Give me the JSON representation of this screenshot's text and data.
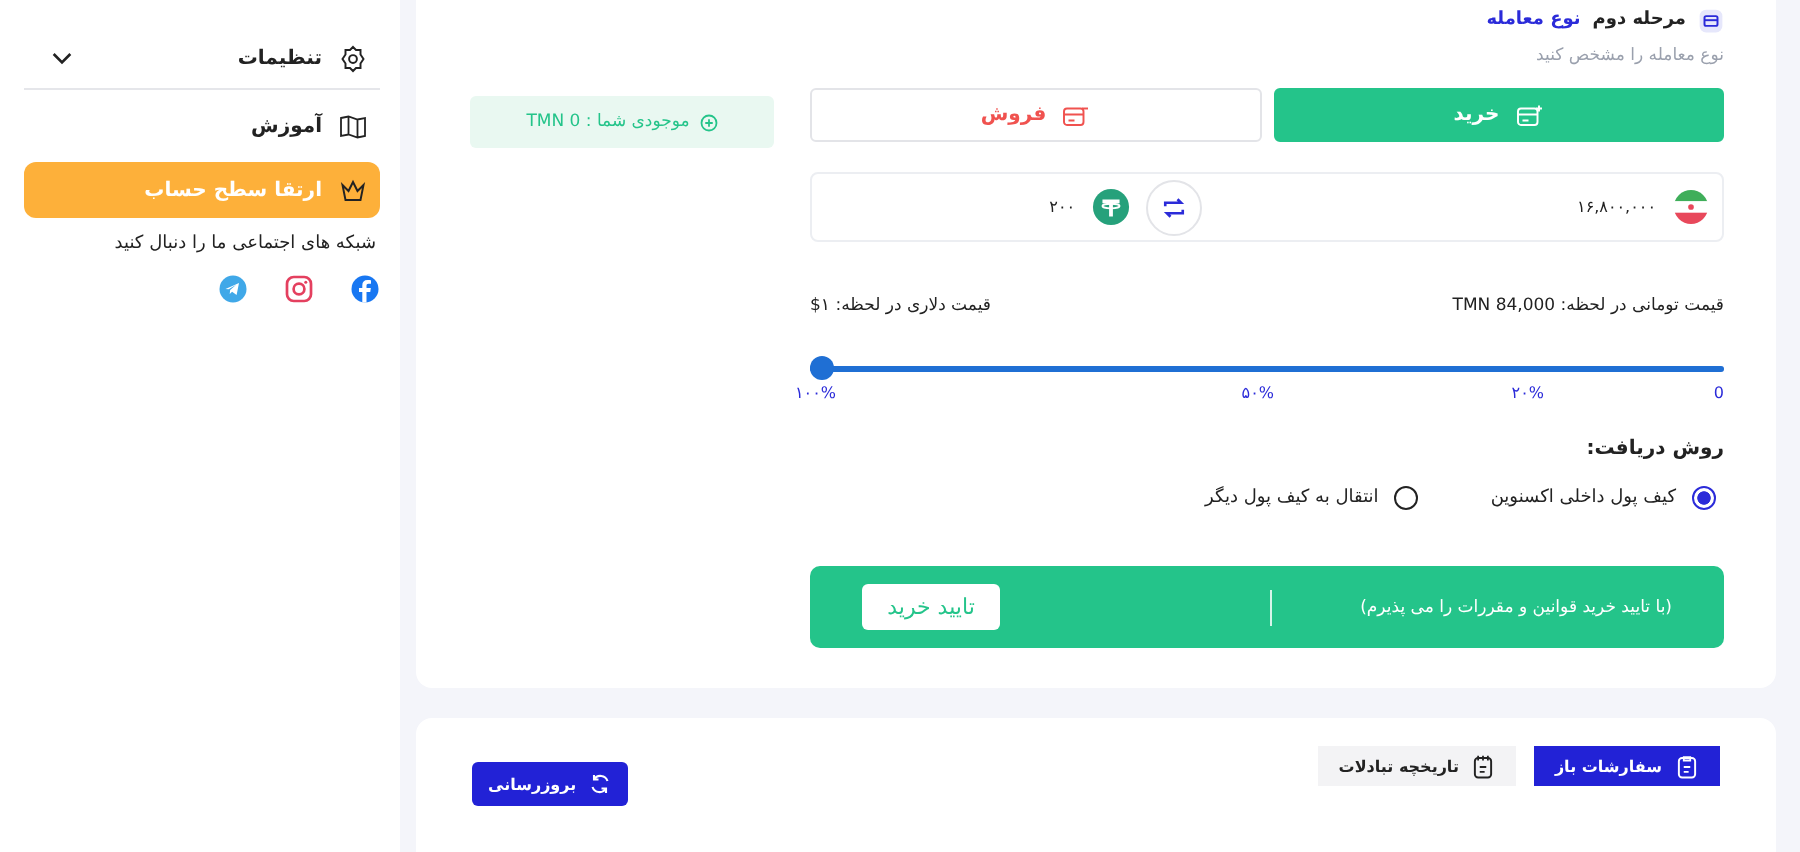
{
  "step": {
    "label": "مرحله دوم",
    "title": "نوع معامله",
    "hint": "نوع معامله را مشخص کنید"
  },
  "trade_types": [
    {
      "label": "خرید",
      "kind": "buy",
      "selected": true
    },
    {
      "label": "فروش",
      "kind": "sell",
      "selected": false
    }
  ],
  "balance": "موجودی شما : TMN 0",
  "converter": {
    "from_amount": "۱۶,۸۰۰,۰۰۰",
    "to_amount": "۲۰۰"
  },
  "prices": {
    "toman": "قیمت تومانی در لحظه: TMN 84,000",
    "dollar": "قیمت دلاری در لحظه: ۱$"
  },
  "slider": {
    "level": 1,
    "ticks": [
      "0",
      "۲۰%",
      "۵۰%",
      "۱۰۰%"
    ]
  },
  "delivery": {
    "label": "روش دریافت:",
    "options": [
      {
        "label": "کیف پول داخلی اکسنوین",
        "selected": true
      },
      {
        "label": "انتقال به کیف پول دیگر",
        "selected": false
      }
    ]
  },
  "confirm": {
    "terms": "(با تایید خرید قوانین و مقررات را می پذیرم)",
    "button": "تایید خرید"
  },
  "orders": {
    "tabs": [
      {
        "label": "سفارشات باز",
        "kind": "open",
        "selected": true
      },
      {
        "label": "تاریخچه تبادلات",
        "kind": "history",
        "selected": false
      }
    ],
    "refresh": "بروزرسانی"
  },
  "sidebar": {
    "items": [
      {
        "label": "تنظیمات",
        "kind": "settings",
        "expanded": false
      },
      {
        "label": "آموزش",
        "kind": "learn"
      },
      {
        "label": "ارتقا سطح حساب",
        "kind": "upgrade"
      }
    ],
    "follow": "شبکه های اجتماعی ما را دنبال کنید",
    "socials": [
      {
        "kind": "facebook"
      },
      {
        "kind": "instagram"
      },
      {
        "kind": "telegram"
      }
    ]
  }
}
